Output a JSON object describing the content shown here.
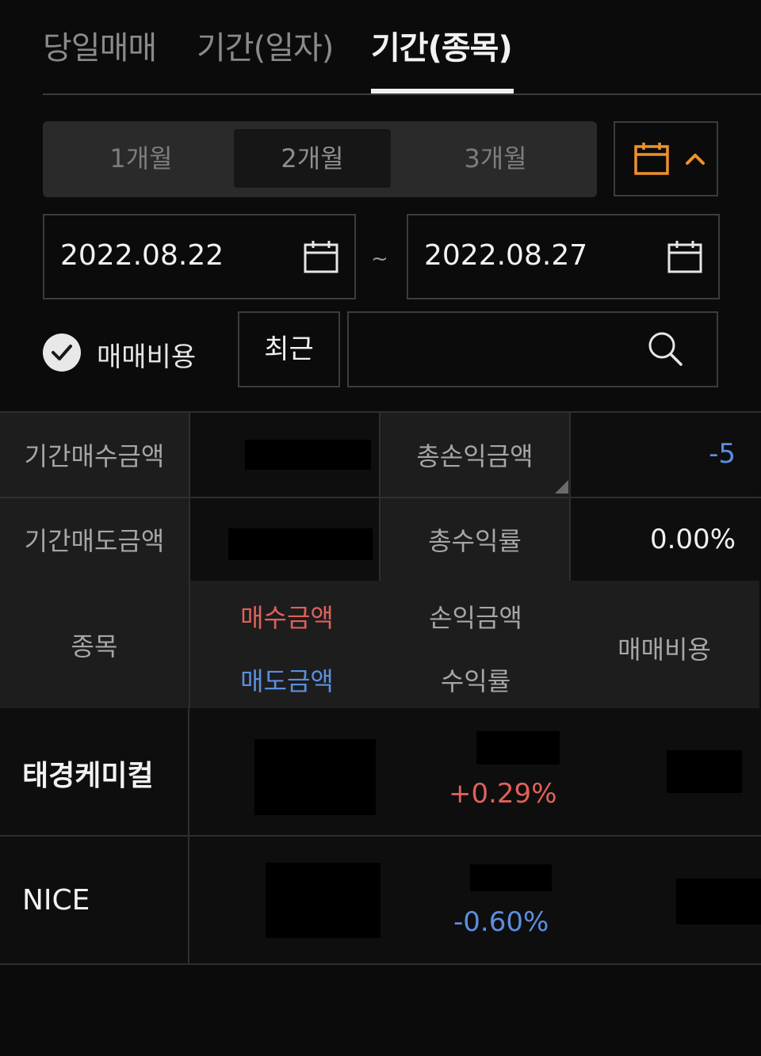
{
  "tabs": [
    {
      "label": "당일매매"
    },
    {
      "label": "기간(일자)"
    },
    {
      "label": "기간(종목)"
    }
  ],
  "period": {
    "options": [
      "1개월",
      "2개월",
      "3개월"
    ],
    "selected": "2개월"
  },
  "dates": {
    "start": "2022.08.22",
    "separator": "~",
    "end": "2022.08.27"
  },
  "filter": {
    "fee_label": "매매비용",
    "fee_checked": true,
    "recent_label": "최근",
    "search_value": ""
  },
  "summary": {
    "buy_label": "기간매수금액",
    "sell_label": "기간매도금액",
    "pnl_label": "총손익금액",
    "pnl_value": "-5",
    "return_label": "총수익률",
    "return_value": "0.00%"
  },
  "columns": {
    "name": "종목",
    "buy_amount": "매수금액",
    "sell_amount": "매도금액",
    "pnl_amount": "손익금액",
    "return_rate": "수익률",
    "fee": "매매비용"
  },
  "rows": [
    {
      "name": "태경케미컬",
      "return_rate": "+0.29%"
    },
    {
      "name": "NICE",
      "return_rate": "-0.60%"
    }
  ],
  "colors": {
    "up": "#e0605a",
    "down": "#5b8ee0",
    "accent": "#f0902c"
  }
}
